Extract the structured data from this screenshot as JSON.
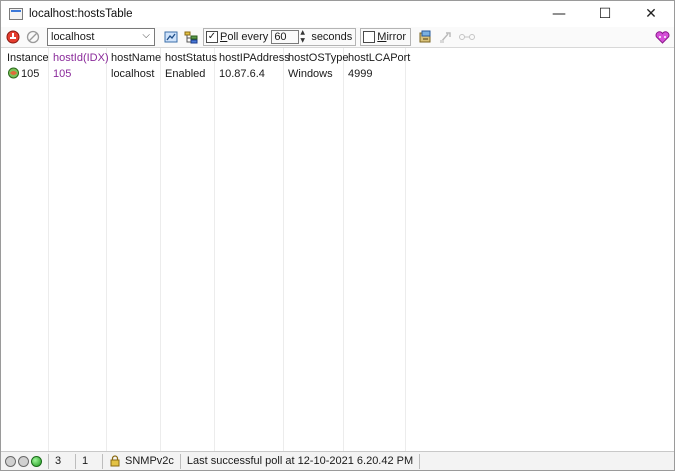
{
  "window": {
    "title": "localhost:hostsTable",
    "minimize_glyph": "—",
    "maximize_glyph": "☐",
    "close_glyph": "✕"
  },
  "toolbar": {
    "host_value": "localhost",
    "poll_checked": true,
    "poll_label_underlined": "P",
    "poll_label_rest": "oll every",
    "poll_interval": "60",
    "poll_unit": "seconds",
    "mirror_checked": false,
    "mirror_label_underlined": "M",
    "mirror_label_rest": "irror",
    "icons": [
      "stop-poll-icon",
      "disabled-circle-icon",
      "refresh-view-icon",
      "tree-view-icon",
      "export-icon",
      "disabled-tool-icon",
      "disabled-link-icon",
      "heart-icon"
    ]
  },
  "table": {
    "columns": [
      {
        "key": "instance",
        "label": "Instance",
        "is_index": false
      },
      {
        "key": "hostId",
        "label": "hostId(IDX)",
        "is_index": true
      },
      {
        "key": "hostName",
        "label": "hostName",
        "is_index": false
      },
      {
        "key": "hostStatus",
        "label": "hostStatus",
        "is_index": false
      },
      {
        "key": "hostIPAddress",
        "label": "hostIPAddress",
        "is_index": false
      },
      {
        "key": "hostOSType",
        "label": "hostOSType",
        "is_index": false
      },
      {
        "key": "hostLCAPort",
        "label": "hostLCAPort",
        "is_index": false
      }
    ],
    "rows": [
      {
        "instance": "105",
        "hostId": "105",
        "hostName": "localhost",
        "hostStatus": "Enabled",
        "hostIPAddress": "10.87.6.4",
        "hostOSType": "Windows",
        "hostLCAPort": "4999"
      }
    ]
  },
  "status": {
    "count_a": "3",
    "count_b": "1",
    "protocol": "SNMPv2c",
    "message": "Last successful poll at 12-10-2021 6.20.42 PM"
  },
  "colors": {
    "index_column": "#8a2a9a",
    "status_ok": "#1c9a1c"
  }
}
